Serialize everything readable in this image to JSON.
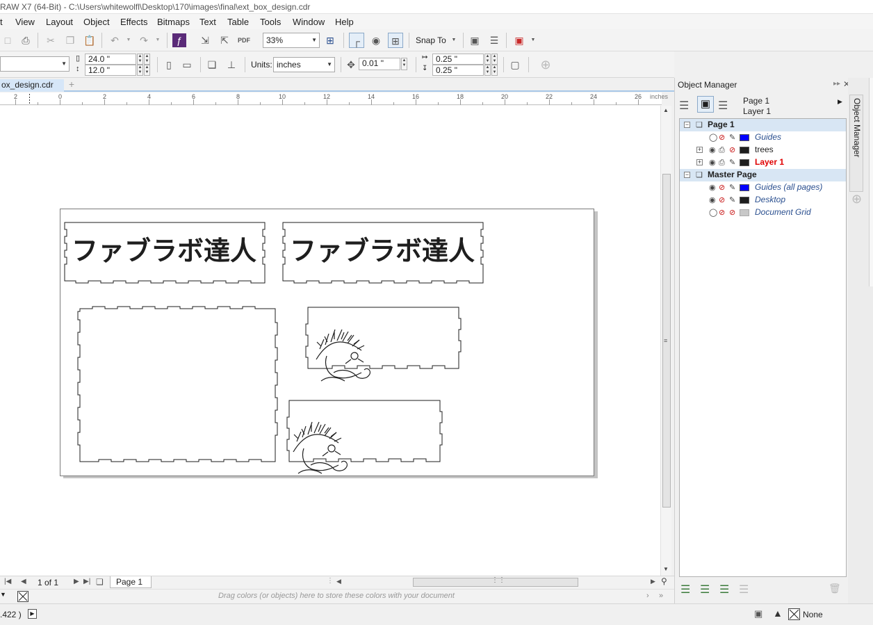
{
  "titlebar": {
    "title": "RAW X7 (64-Bit) - C:\\Users\\whitewolfl\\Desktop\\170\\images\\final\\ext_box_design.cdr"
  },
  "menu": [
    "t",
    "View",
    "Layout",
    "Object",
    "Effects",
    "Bitmaps",
    "Text",
    "Table",
    "Tools",
    "Window",
    "Help"
  ],
  "toolbar": {
    "zoom": "33%",
    "snap_to": "Snap To"
  },
  "propbar": {
    "width": "24.0 \"",
    "height": "12.0 \"",
    "units_label": "Units:",
    "units": "inches",
    "nudge": "0.01 \"",
    "dup_x": "0.25 \"",
    "dup_y": "0.25 \""
  },
  "document": {
    "tab": "ox_design.cdr"
  },
  "ruler": {
    "unit": "inches",
    "labels": [
      "2",
      "0",
      "2",
      "4",
      "6",
      "8",
      "10",
      "12",
      "14",
      "16",
      "18",
      "20",
      "22",
      "24",
      "26"
    ]
  },
  "design": {
    "header_text_1": "ファブラボ達人",
    "header_text_2": "ファブラボ達人"
  },
  "nav": {
    "page_count": "1 of 1",
    "page_tab": "Page 1"
  },
  "palette": {
    "hint": "Drag colors (or objects) here to store these colors with your document"
  },
  "status": {
    "coords": ".422 )",
    "fill": "None"
  },
  "object_manager": {
    "title": "Object Manager",
    "current_page": "Page 1",
    "current_layer": "Layer 1",
    "side_tab": "Object Manager",
    "tree": [
      {
        "type": "page",
        "name": "Page 1"
      },
      {
        "type": "layer",
        "name": "Guides",
        "color": "#0000ff",
        "expandable": false,
        "style": "normal"
      },
      {
        "type": "layer",
        "name": "trees",
        "color": "#1e1e1e",
        "expandable": true,
        "style": "normal"
      },
      {
        "type": "layer",
        "name": "Layer 1",
        "color": "#1e1e1e",
        "expandable": true,
        "style": "active"
      },
      {
        "type": "page",
        "name": "Master Page"
      },
      {
        "type": "layer",
        "name": "Guides (all pages)",
        "color": "#0000ff",
        "expandable": false,
        "style": "italic"
      },
      {
        "type": "layer",
        "name": "Desktop",
        "color": "#1e1e1e",
        "expandable": false,
        "style": "italic"
      },
      {
        "type": "layer",
        "name": "Document Grid",
        "color": "#c8c8c8",
        "expandable": false,
        "style": "italic"
      }
    ]
  },
  "colors": {
    "accent": "#a8c8e8",
    "active_layer": "#e00000",
    "guides": "#0000ff"
  }
}
